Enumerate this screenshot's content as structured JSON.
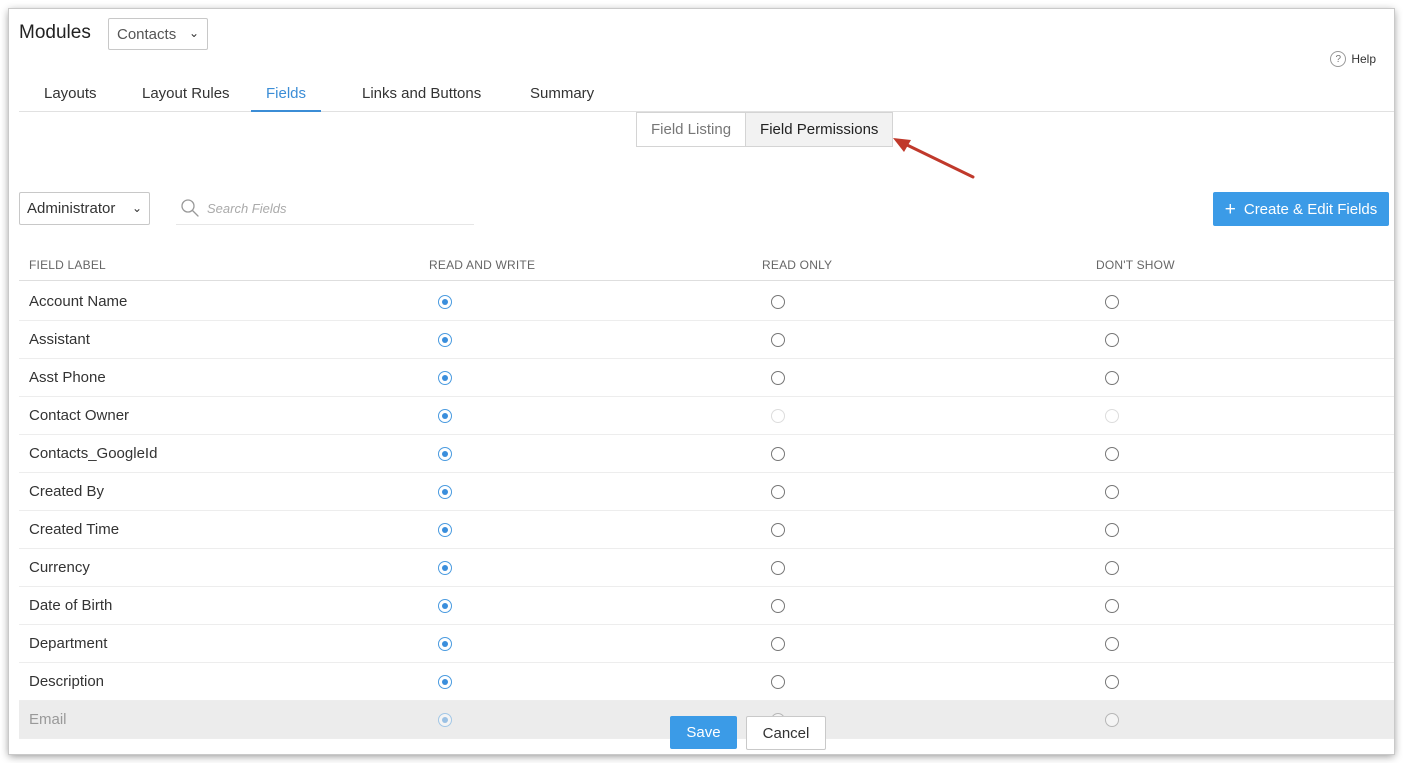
{
  "header": {
    "title": "Modules",
    "module_select_value": "Contacts",
    "help_label": "Help"
  },
  "tabs": [
    {
      "label": "Layouts",
      "active": false
    },
    {
      "label": "Layout Rules",
      "active": false
    },
    {
      "label": "Fields",
      "active": true
    },
    {
      "label": "Links and Buttons",
      "active": false
    },
    {
      "label": "Summary",
      "active": false
    }
  ],
  "subtabs": [
    {
      "label": "Field Listing",
      "active": false
    },
    {
      "label": "Field Permissions",
      "active": true
    }
  ],
  "toolbar": {
    "profile_value": "Administrator",
    "search_placeholder": "Search Fields",
    "create_button_label": "Create & Edit Fields"
  },
  "table": {
    "headers": [
      "FIELD LABEL",
      "READ AND WRITE",
      "READ ONLY",
      "DON'T SHOW"
    ],
    "rows": [
      {
        "label": "Account Name",
        "permission": "read_write",
        "disabled_others": false
      },
      {
        "label": "Assistant",
        "permission": "read_write",
        "disabled_others": false
      },
      {
        "label": "Asst Phone",
        "permission": "read_write",
        "disabled_others": false
      },
      {
        "label": "Contact Owner",
        "permission": "read_write",
        "disabled_others": true
      },
      {
        "label": "Contacts_GoogleId",
        "permission": "read_write",
        "disabled_others": false
      },
      {
        "label": "Created By",
        "permission": "read_write",
        "disabled_others": false
      },
      {
        "label": "Created Time",
        "permission": "read_write",
        "disabled_others": false
      },
      {
        "label": "Currency",
        "permission": "read_write",
        "disabled_others": false
      },
      {
        "label": "Date of Birth",
        "permission": "read_write",
        "disabled_others": false
      },
      {
        "label": "Department",
        "permission": "read_write",
        "disabled_others": false
      },
      {
        "label": "Description",
        "permission": "read_write",
        "disabled_others": false
      },
      {
        "label": "Email",
        "permission": "read_write",
        "disabled_others": false,
        "dimmed": true
      }
    ]
  },
  "footer": {
    "save_label": "Save",
    "cancel_label": "Cancel"
  },
  "colors": {
    "accent": "#3b9be7",
    "active_tab": "#3b8dd6",
    "annotation_arrow": "#c0392b"
  }
}
